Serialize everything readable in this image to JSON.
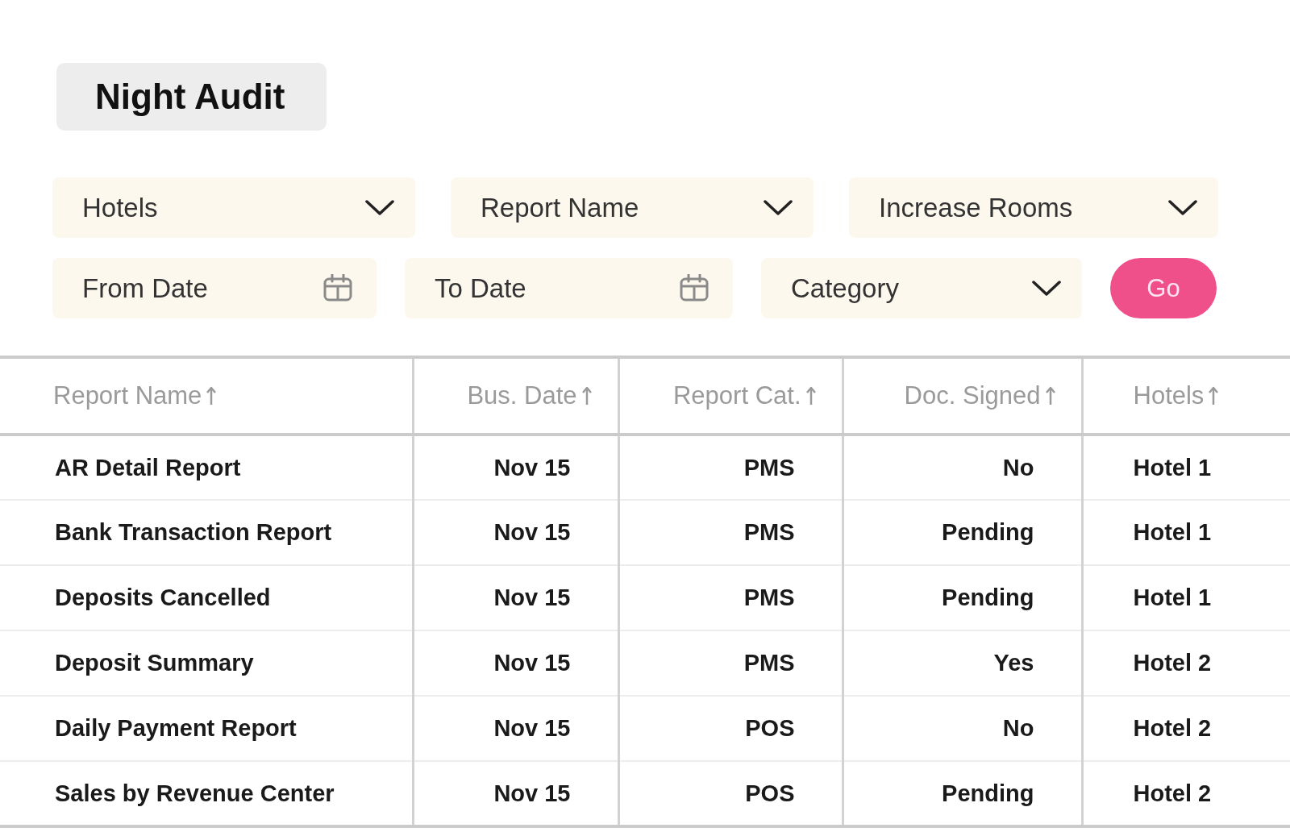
{
  "page": {
    "title": "Night Audit"
  },
  "filter_rows": [
    {
      "fields": [
        {
          "kind": "select",
          "placeholder": "Hotels"
        },
        {
          "kind": "select",
          "placeholder": "Report Name"
        },
        {
          "kind": "select",
          "placeholder": "Increase Rooms"
        }
      ]
    },
    {
      "fields": [
        {
          "kind": "date",
          "placeholder": "From Date"
        },
        {
          "kind": "date",
          "placeholder": "To Date"
        },
        {
          "kind": "select",
          "placeholder": "Category"
        },
        {
          "kind": "button",
          "label": "Go"
        }
      ]
    }
  ],
  "table": {
    "columns": [
      {
        "label": "Report Name"
      },
      {
        "label": "Bus. Date"
      },
      {
        "label": "Report Cat."
      },
      {
        "label": "Doc. Signed"
      },
      {
        "label": "Hotels"
      }
    ],
    "rows": [
      {
        "cells": [
          "AR Detail Report",
          "Nov 15",
          "PMS",
          "No",
          "Hotel 1"
        ]
      },
      {
        "cells": [
          "Bank Transaction Report",
          "Nov 15",
          "PMS",
          "Pending",
          "Hotel 1"
        ]
      },
      {
        "cells": [
          "Deposits Cancelled",
          "Nov 15",
          "PMS",
          "Pending",
          "Hotel 1"
        ]
      },
      {
        "cells": [
          "Deposit Summary",
          "Nov 15",
          "PMS",
          "Yes",
          "Hotel 2"
        ]
      },
      {
        "cells": [
          "Daily Payment Report",
          "Nov 15",
          "POS",
          "No",
          "Hotel 2"
        ]
      },
      {
        "cells": [
          "Sales by Revenue Center",
          "Nov 15",
          "POS",
          "Pending",
          "Hotel 2"
        ]
      }
    ]
  }
}
